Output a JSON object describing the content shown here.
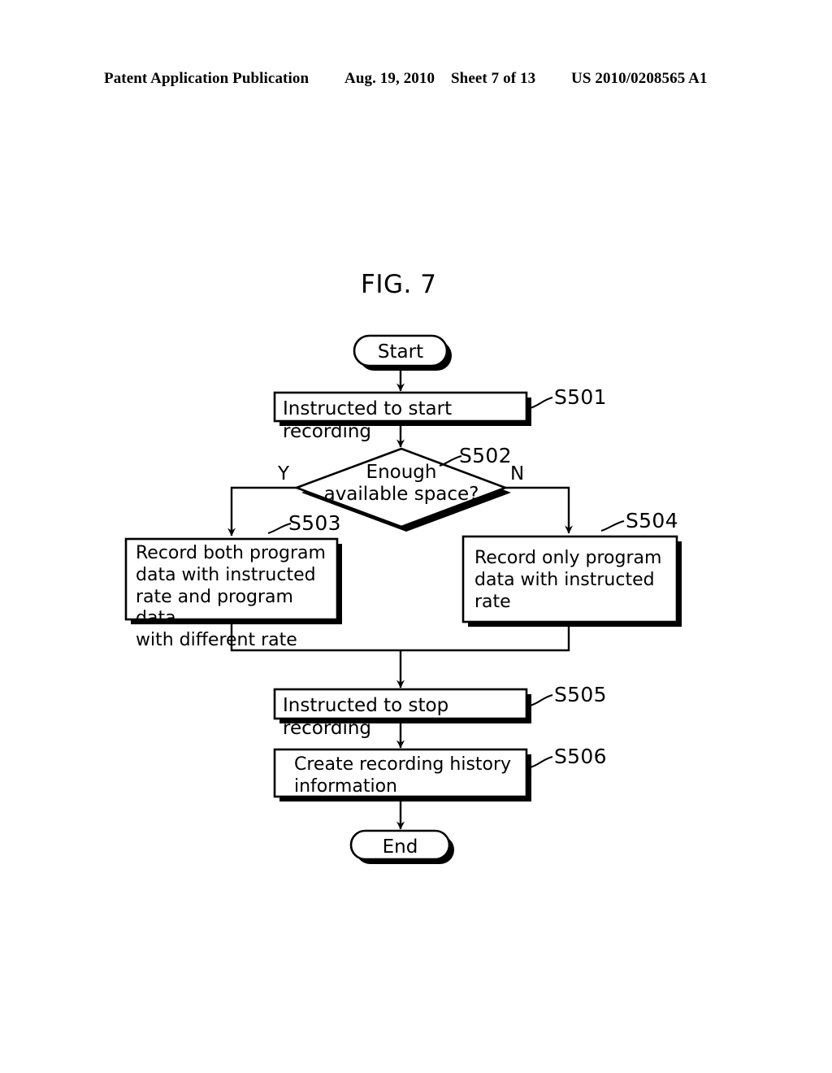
{
  "header": {
    "publication": "Patent Application Publication",
    "date": "Aug. 19, 2010",
    "sheet": "Sheet 7 of 13",
    "patent_number": "US 2010/0208565 A1"
  },
  "figure": {
    "label": "FIG. 7",
    "type": "flowchart"
  },
  "nodes": {
    "start": {
      "label": "Start",
      "shape": "terminator"
    },
    "s501": {
      "label": "Instructed to start recording",
      "ref": "S501",
      "shape": "process"
    },
    "s502": {
      "label": "Enough\navailable space?",
      "ref": "S502",
      "shape": "decision"
    },
    "s503": {
      "label": "Record both program\ndata with instructed\nrate and program data\nwith different rate",
      "ref": "S503",
      "shape": "process"
    },
    "s504": {
      "label": "Record only program\ndata with instructed\nrate",
      "ref": "S504",
      "shape": "process"
    },
    "s505": {
      "label": "Instructed to stop recording",
      "ref": "S505",
      "shape": "process"
    },
    "s506": {
      "label": "Create recording history\ninformation",
      "ref": "S506",
      "shape": "process"
    },
    "end": {
      "label": "End",
      "shape": "terminator"
    }
  },
  "branches": {
    "yes": "Y",
    "no": "N"
  },
  "colors": {
    "ink": "#000000",
    "paper": "#ffffff"
  }
}
